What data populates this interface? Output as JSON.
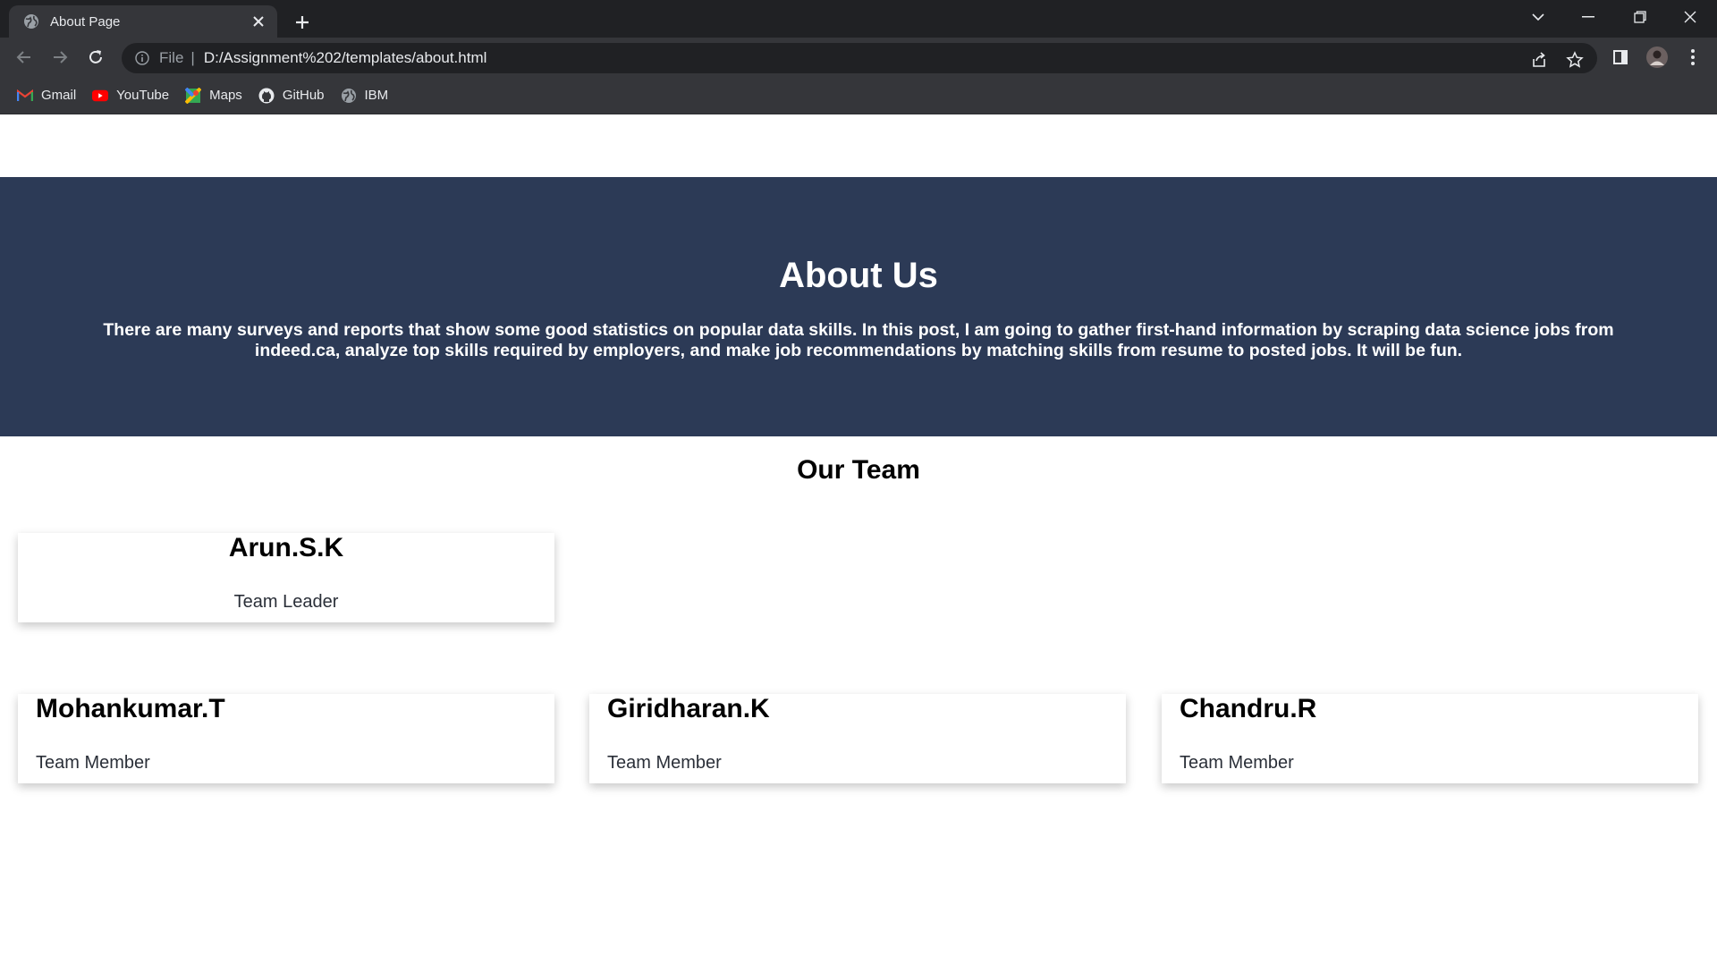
{
  "browser": {
    "tab_title": "About Page",
    "url_scheme": "File",
    "url": "D:/Assignment%202/templates/about.html",
    "bookmarks": [
      {
        "label": "Gmail",
        "icon": "gmail-icon"
      },
      {
        "label": "YouTube",
        "icon": "youtube-icon"
      },
      {
        "label": "Maps",
        "icon": "maps-icon"
      },
      {
        "label": "GitHub",
        "icon": "github-icon"
      },
      {
        "label": "IBM",
        "icon": "globe-icon"
      }
    ]
  },
  "hero": {
    "title": "About Us",
    "text": "There are many surveys and reports that show some good statistics on popular data skills. In this post, I am going to gather first-hand information by scraping data science jobs from indeed.ca, analyze top skills required by employers, and make job recommendations by matching skills from resume to posted jobs. It will be fun."
  },
  "team": {
    "title": "Our Team",
    "leader": {
      "name": "Arun.S.K",
      "role": "Team Leader"
    },
    "members": [
      {
        "name": "Mohankumar.T",
        "role": "Team Member"
      },
      {
        "name": "Giridharan.K",
        "role": "Team Member"
      },
      {
        "name": "Chandru.R",
        "role": "Team Member"
      }
    ]
  },
  "colors": {
    "hero_bg": "#2c3a56",
    "chrome_dark": "#202124",
    "chrome_mid": "#35363a"
  }
}
